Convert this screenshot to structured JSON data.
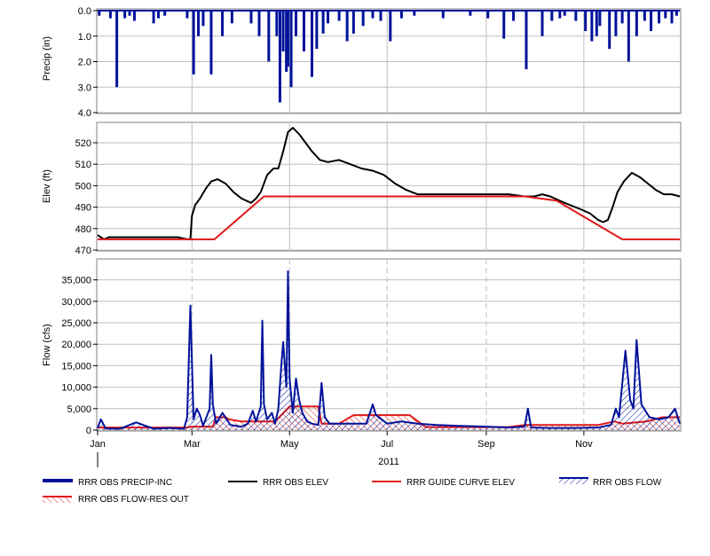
{
  "colors": {
    "precip": "#00129A",
    "elev": "#000000",
    "guide": "#E01818",
    "flow": "#00129A",
    "flow_res_out": "#E01818",
    "grid": "#BFBFBF"
  },
  "chart_data": [
    {
      "type": "bar",
      "title": "",
      "ylabel": "Precip (in)",
      "ylim": [
        4.0,
        0.0
      ],
      "inverted_y": true,
      "yticks": [
        "0.0",
        "1.0",
        "2.0",
        "3.0",
        "4.0"
      ],
      "grid": true,
      "series": [
        {
          "name": "RRR OBS PRECIP-INC",
          "x": [
            "2011-01-02",
            "2011-01-09",
            "2011-01-13",
            "2011-01-18",
            "2011-01-21",
            "2011-01-24",
            "2011-02-05",
            "2011-02-08",
            "2011-02-12",
            "2011-02-26",
            "2011-03-02",
            "2011-03-05",
            "2011-03-08",
            "2011-03-13",
            "2011-03-20",
            "2011-03-26",
            "2011-04-07",
            "2011-04-12",
            "2011-04-18",
            "2011-04-23",
            "2011-04-25",
            "2011-04-27",
            "2011-04-29",
            "2011-04-30",
            "2011-05-02",
            "2011-05-05",
            "2011-05-10",
            "2011-05-15",
            "2011-05-18",
            "2011-05-22",
            "2011-05-25",
            "2011-06-01",
            "2011-06-06",
            "2011-06-10",
            "2011-06-16",
            "2011-06-22",
            "2011-06-27",
            "2011-07-03",
            "2011-07-10",
            "2011-07-18",
            "2011-08-05",
            "2011-08-22",
            "2011-09-02",
            "2011-09-12",
            "2011-09-18",
            "2011-09-26",
            "2011-10-06",
            "2011-10-12",
            "2011-10-17",
            "2011-10-20",
            "2011-10-27",
            "2011-11-02",
            "2011-11-06",
            "2011-11-09",
            "2011-11-11",
            "2011-11-17",
            "2011-11-21",
            "2011-11-25",
            "2011-11-29",
            "2011-12-04",
            "2011-12-09",
            "2011-12-13",
            "2011-12-18",
            "2011-12-22",
            "2011-12-26",
            "2011-12-29"
          ],
          "values": [
            0.2,
            0.3,
            3.0,
            0.3,
            0.2,
            0.4,
            0.5,
            0.3,
            0.2,
            0.3,
            2.5,
            1.0,
            0.6,
            2.5,
            1.0,
            0.5,
            0.5,
            1.0,
            2.0,
            1.0,
            3.6,
            1.6,
            2.4,
            2.2,
            3.0,
            1.0,
            1.6,
            2.6,
            1.5,
            0.9,
            0.5,
            0.4,
            1.2,
            0.9,
            0.6,
            0.3,
            0.4,
            1.2,
            0.3,
            0.2,
            0.3,
            0.2,
            0.3,
            1.1,
            0.4,
            2.3,
            1.0,
            0.4,
            0.3,
            0.2,
            0.4,
            0.8,
            1.2,
            1.0,
            0.6,
            1.5,
            1.0,
            0.5,
            2.0,
            1.0,
            0.4,
            0.8,
            0.5,
            0.3,
            0.5,
            0.2
          ]
        }
      ]
    },
    {
      "type": "line",
      "title": "",
      "ylabel": "Elev (ft)",
      "ylim": [
        470,
        528
      ],
      "yticks": [
        "470",
        "480",
        "490",
        "500",
        "510",
        "520"
      ],
      "grid": true,
      "series": [
        {
          "name": "RRR OBS ELEV",
          "x": [
            "2011-01-01",
            "2011-01-03",
            "2011-01-05",
            "2011-01-08",
            "2011-01-14",
            "2011-01-20",
            "2011-01-25",
            "2011-01-30",
            "2011-02-05",
            "2011-02-10",
            "2011-02-14",
            "2011-02-20",
            "2011-02-26",
            "2011-02-28",
            "2011-03-01",
            "2011-03-03",
            "2011-03-06",
            "2011-03-10",
            "2011-03-13",
            "2011-03-17",
            "2011-03-22",
            "2011-03-27",
            "2011-04-01",
            "2011-04-07",
            "2011-04-10",
            "2011-04-13",
            "2011-04-17",
            "2011-04-21",
            "2011-04-24",
            "2011-04-27",
            "2011-04-30",
            "2011-05-03",
            "2011-05-07",
            "2011-05-11",
            "2011-05-15",
            "2011-05-20",
            "2011-05-25",
            "2011-06-01",
            "2011-06-08",
            "2011-06-15",
            "2011-06-22",
            "2011-06-29",
            "2011-07-06",
            "2011-07-13",
            "2011-07-20",
            "2011-07-27",
            "2011-08-05",
            "2011-08-15",
            "2011-08-25",
            "2011-09-05",
            "2011-09-15",
            "2011-09-25",
            "2011-10-01",
            "2011-10-06",
            "2011-10-11",
            "2011-10-20",
            "2011-10-30",
            "2011-11-05",
            "2011-11-10",
            "2011-11-13",
            "2011-11-16",
            "2011-11-19",
            "2011-11-22",
            "2011-11-26",
            "2011-12-01",
            "2011-12-06",
            "2011-12-11",
            "2011-12-16",
            "2011-12-21",
            "2011-12-26",
            "2011-12-31"
          ],
          "values": [
            477,
            476,
            475,
            476,
            476,
            476,
            476,
            476,
            476,
            476,
            476,
            476,
            475,
            475,
            486,
            491,
            494,
            499,
            502,
            503,
            501,
            497,
            494,
            492,
            494,
            497,
            505,
            508,
            508,
            516,
            525,
            527,
            524,
            520,
            516,
            512,
            511,
            512,
            510,
            508,
            507,
            505,
            501,
            498,
            496,
            496,
            496,
            496,
            496,
            496,
            496,
            495,
            495,
            496,
            495,
            492,
            489,
            487,
            484,
            483,
            484,
            490,
            497,
            502,
            506,
            504,
            501,
            498,
            496,
            496,
            495
          ]
        },
        {
          "name": "RRR GUIDE CURVE ELEV",
          "x": [
            "2011-01-01",
            "2011-03-15",
            "2011-04-15",
            "2011-09-25",
            "2011-10-15",
            "2011-11-25",
            "2011-12-31"
          ],
          "values": [
            475,
            475,
            495,
            495,
            493,
            475,
            475
          ]
        }
      ]
    },
    {
      "type": "area",
      "title": "",
      "ylabel": "Flow (cfs)",
      "xlabel": "2011",
      "ylim": [
        0,
        37000
      ],
      "yticks": [
        "0",
        "5,000",
        "10,000",
        "15,000",
        "20,000",
        "25,000",
        "30,000",
        "35,000"
      ],
      "xticks": [
        {
          "label": "Jan",
          "date": "2011-01-01"
        },
        {
          "label": "Mar",
          "date": "2011-03-01"
        },
        {
          "label": "May",
          "date": "2011-05-01"
        },
        {
          "label": "Jul",
          "date": "2011-07-01"
        },
        {
          "label": "Sep",
          "date": "2011-09-01"
        },
        {
          "label": "Nov",
          "date": "2011-11-01"
        }
      ],
      "grid": true,
      "series": [
        {
          "name": "RRR OBS FLOW",
          "x": [
            "2011-01-01",
            "2011-01-03",
            "2011-01-06",
            "2011-01-15",
            "2011-01-25",
            "2011-02-05",
            "2011-02-15",
            "2011-02-24",
            "2011-02-26",
            "2011-02-28",
            "2011-03-02",
            "2011-03-04",
            "2011-03-06",
            "2011-03-08",
            "2011-03-12",
            "2011-03-13",
            "2011-03-14",
            "2011-03-16",
            "2011-03-20",
            "2011-03-25",
            "2011-04-01",
            "2011-04-05",
            "2011-04-08",
            "2011-04-10",
            "2011-04-13",
            "2011-04-14",
            "2011-04-15",
            "2011-04-17",
            "2011-04-20",
            "2011-04-22",
            "2011-04-24",
            "2011-04-26",
            "2011-04-27",
            "2011-04-29",
            "2011-04-30",
            "2011-05-01",
            "2011-05-03",
            "2011-05-05",
            "2011-05-07",
            "2011-05-09",
            "2011-05-12",
            "2011-05-15",
            "2011-05-19",
            "2011-05-21",
            "2011-05-23",
            "2011-05-26",
            "2011-06-01",
            "2011-06-10",
            "2011-06-18",
            "2011-06-22",
            "2011-06-24",
            "2011-07-01",
            "2011-07-10",
            "2011-07-20",
            "2011-08-01",
            "2011-08-15",
            "2011-09-01",
            "2011-09-15",
            "2011-09-25",
            "2011-09-27",
            "2011-09-29",
            "2011-10-10",
            "2011-10-25",
            "2011-11-10",
            "2011-11-18",
            "2011-11-21",
            "2011-11-23",
            "2011-11-27",
            "2011-11-30",
            "2011-12-02",
            "2011-12-04",
            "2011-12-07",
            "2011-12-12",
            "2011-12-18",
            "2011-12-24",
            "2011-12-28",
            "2011-12-31"
          ],
          "values": [
            500,
            2500,
            400,
            300,
            1800,
            300,
            500,
            300,
            3000,
            29000,
            2500,
            5000,
            3500,
            1000,
            5000,
            17500,
            6000,
            1500,
            4000,
            1200,
            800,
            1500,
            4500,
            2000,
            5500,
            25500,
            6000,
            2500,
            4000,
            1500,
            5000,
            16000,
            20500,
            10000,
            37000,
            12000,
            4000,
            12000,
            7000,
            4000,
            2000,
            1500,
            1200,
            11000,
            3000,
            1500,
            1500,
            1500,
            1500,
            6000,
            3500,
            1500,
            2000,
            1500,
            1200,
            1000,
            800,
            600,
            800,
            5000,
            600,
            500,
            500,
            600,
            1200,
            5000,
            3000,
            18500,
            7000,
            5000,
            21000,
            6000,
            3000,
            2500,
            3000,
            5000,
            1500
          ]
        },
        {
          "name": "RRR OBS FLOW-RES OUT",
          "x": [
            "2011-01-01",
            "2011-02-25",
            "2011-03-01",
            "2011-03-14",
            "2011-03-16",
            "2011-03-22",
            "2011-03-24",
            "2011-04-01",
            "2011-04-22",
            "2011-05-01",
            "2011-05-19",
            "2011-05-21",
            "2011-06-01",
            "2011-06-10",
            "2011-06-20",
            "2011-07-15",
            "2011-07-25",
            "2011-09-15",
            "2011-09-25",
            "2011-10-15",
            "2011-11-10",
            "2011-11-20",
            "2011-11-25",
            "2011-12-10",
            "2011-12-20",
            "2011-12-31"
          ],
          "values": [
            600,
            600,
            800,
            800,
            3000,
            3000,
            2500,
            2000,
            2000,
            5500,
            5500,
            1500,
            1500,
            3500,
            3500,
            3500,
            700,
            700,
            1200,
            1200,
            1200,
            2000,
            1500,
            2000,
            3000,
            3000
          ]
        }
      ]
    }
  ]
}
